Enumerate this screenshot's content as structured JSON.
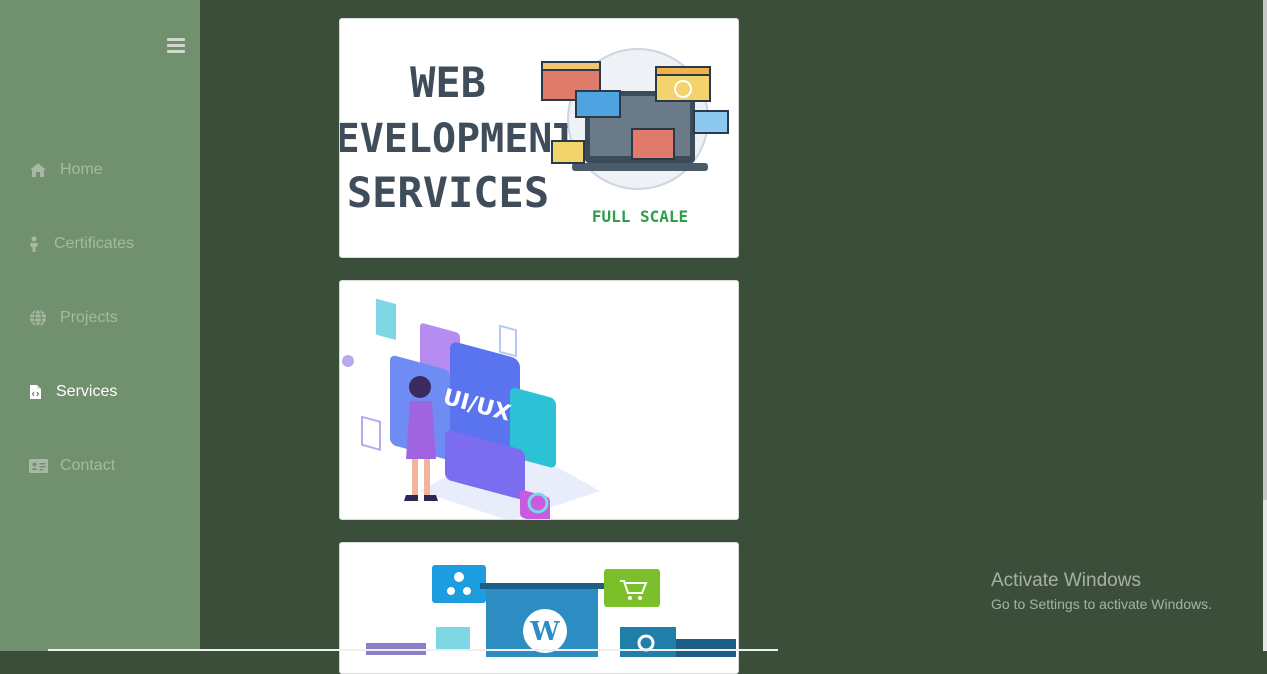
{
  "sidebar": {
    "toggle_icon": "hamburger-icon",
    "items": [
      {
        "label": "Home",
        "icon": "home-icon",
        "active": false
      },
      {
        "label": "Certificates",
        "icon": "person-icon",
        "active": false
      },
      {
        "label": "Projects",
        "icon": "globe-icon",
        "active": false
      },
      {
        "label": "Services",
        "icon": "file-code-icon",
        "active": true
      },
      {
        "label": "Contact",
        "icon": "id-card-icon",
        "active": false
      }
    ]
  },
  "cards": [
    {
      "title_lines": [
        "WEB",
        "DEVELOPMENT",
        "SERVICES"
      ],
      "tagline": "FULL SCALE"
    },
    {
      "badge": "UI/UX"
    },
    {
      "logo": "W"
    }
  ],
  "watermark": {
    "title": "Activate Windows",
    "subtitle": "Go to Settings to activate Windows."
  },
  "colors": {
    "background": "#3b4e3a",
    "sidebar": "#71906d",
    "nav_text": "#a7b9a4",
    "nav_active": "#ffffff"
  }
}
